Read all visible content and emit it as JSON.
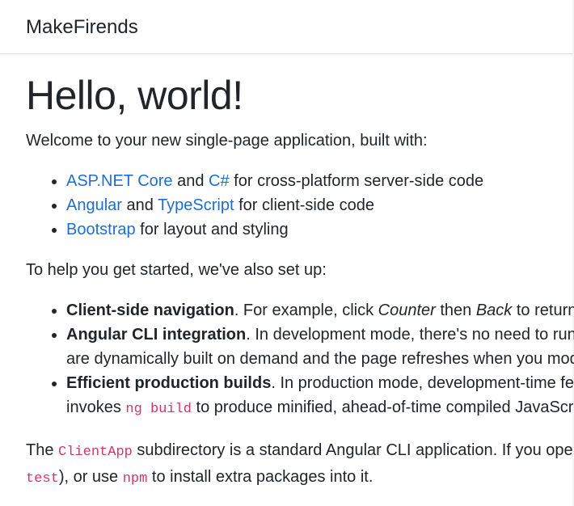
{
  "navbar": {
    "brand": "MakeFirends"
  },
  "hero": {
    "title": "Hello, world!"
  },
  "intro": "Welcome to your new single-page application, built with:",
  "built_with": [
    {
      "link1": "ASP.NET Core",
      "mid": " and ",
      "link2": "C#",
      "rest": " for cross-platform server-side code"
    },
    {
      "link1": "Angular",
      "mid": " and ",
      "link2": "TypeScript",
      "rest": " for client-side code"
    },
    {
      "link1": "Bootstrap",
      "rest": " for layout and styling"
    }
  ],
  "setup_intro": "To help you get started, we've also set up:",
  "features": [
    {
      "title": "Client-side navigation",
      "t1": ". For example, click ",
      "em1": "Counter",
      "t2": " then ",
      "em2": "Back",
      "t3": " to return h"
    },
    {
      "title": "Angular CLI integration",
      "line1": ". In development mode, there's no need to run",
      "line2": "are dynamically built on demand and the page refreshes when you mod"
    },
    {
      "title": "Efficient production builds",
      "line1": ". In production mode, development-time fe",
      "pre": "invokes ",
      "code": "ng build",
      "post": " to produce minified, ahead-of-time compiled JavaScri"
    }
  ],
  "footer_para": {
    "t1": "The ",
    "code1": "ClientApp",
    "t2": " subdirectory is a standard Angular CLI application. If you open",
    "code2": "test",
    "t3": "), or use ",
    "code3": "npm",
    "t4": " to install extra packages into it."
  },
  "colors": {
    "link": "#1e6fcc",
    "code": "#d6336c",
    "text": "#212529"
  }
}
